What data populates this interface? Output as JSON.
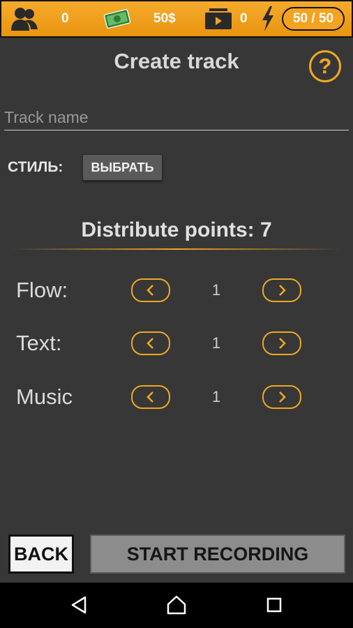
{
  "topbar": {
    "fans": "0",
    "money": "50$",
    "videos": "0",
    "energy": "50 / 50",
    "icons": {
      "fans": "people-icon",
      "money": "cash-icon",
      "videos": "video-icon",
      "energy": "lightning-icon"
    }
  },
  "title": "Create track",
  "help_icon": "?",
  "track_name_placeholder": "Track name",
  "style": {
    "label": "СТИЛЬ:",
    "button": "ВЫБРАТЬ"
  },
  "points": "Distribute points: 7",
  "stats": [
    {
      "label": "Flow:",
      "value": "1"
    },
    {
      "label": "Text:",
      "value": "1"
    },
    {
      "label": "Music",
      "value": "1"
    }
  ],
  "buttons": {
    "back": "BACK",
    "start": "START RECORDING"
  },
  "colors": {
    "accent": "#f0a820",
    "background": "#373737",
    "topbar": "#f4a321"
  }
}
